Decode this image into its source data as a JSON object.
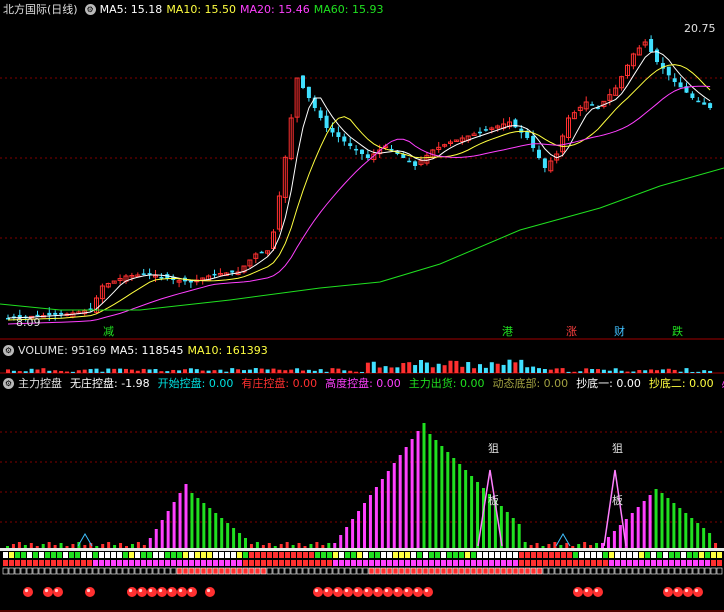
{
  "main_panel": {
    "title": "北方国际(日线)",
    "ma5": "MA5: 15.18",
    "ma10": "MA10: 15.50",
    "ma20": "MA20: 15.46",
    "ma60": "MA60: 15.93",
    "high_label": "20.75",
    "low_label": "8.09",
    "signal_labels": [
      "减",
      "港",
      "涨",
      "财",
      "跌"
    ]
  },
  "volume_panel": {
    "title": "VOLUME: 95169",
    "ma5": "MA5: 118545",
    "ma10": "MA10: 161393"
  },
  "indicator_panel": {
    "title": "主力控盘",
    "items": [
      {
        "text": "无庄控盘: -1.98",
        "color": "#ffffff"
      },
      {
        "text": "开始控盘: 0.00",
        "color": "#00e0e0"
      },
      {
        "text": "有庄控盘: 0.00",
        "color": "#ff3030"
      },
      {
        "text": "高度控盘: 0.00",
        "color": "#ff40ff"
      },
      {
        "text": "主力出货: 0.00",
        "color": "#20e020"
      },
      {
        "text": "动态底部: 0.00",
        "color": "#a0a040"
      },
      {
        "text": "抄底一: 0.00",
        "color": "#ffffff"
      },
      {
        "text": "抄底二: 0.00",
        "color": "#ffff40"
      },
      {
        "text": "必",
        "color": "#ff40ff"
      }
    ],
    "annotation_chars": [
      "狙",
      "板",
      "狙",
      "板"
    ]
  },
  "colors": {
    "up": "#ff3030",
    "down": "#40e0ff",
    "ma5": "#ffffff",
    "ma10": "#ffff40",
    "ma20": "#ff40ff",
    "ma60": "#20e020",
    "grid": "#800000",
    "divider": "#a00000"
  }
}
